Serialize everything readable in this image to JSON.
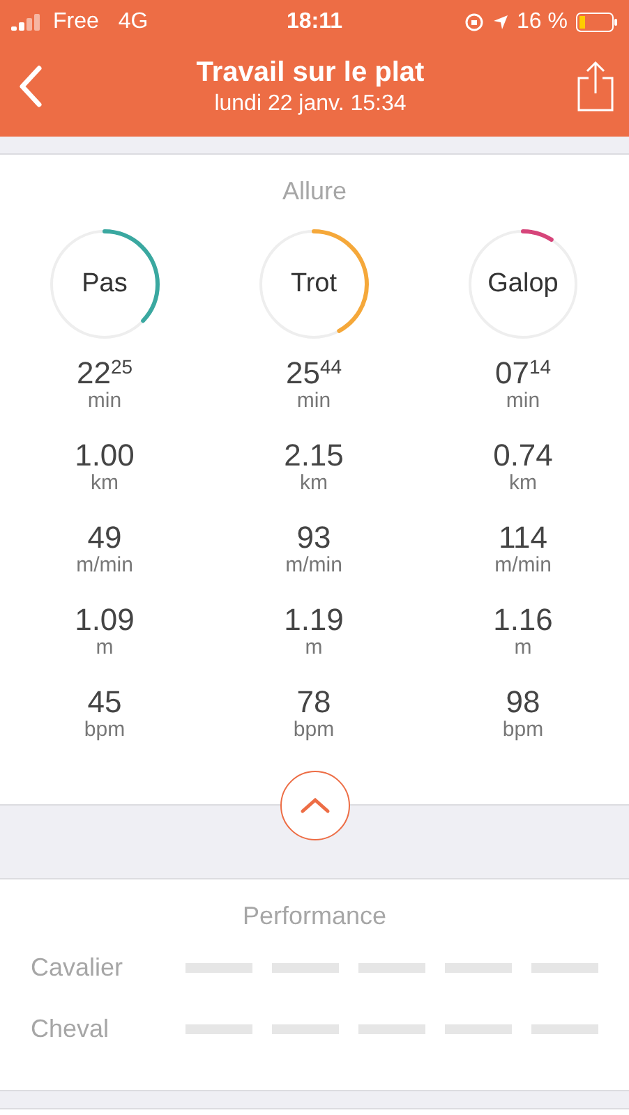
{
  "status_bar": {
    "carrier": "Free",
    "network": "4G",
    "time": "18:11",
    "battery": "16 %"
  },
  "header": {
    "title": "Travail sur le plat",
    "subtitle": "lundi 22 janv. 15:34"
  },
  "allure": {
    "title": "Allure",
    "gaits": [
      {
        "name": "Pas",
        "level": 0.37,
        "color": "#3aa8a0",
        "stats": [
          {
            "value": "22$^{25}$",
            "unit": "min"
          },
          {
            "value": "1.00",
            "unit": "km"
          },
          {
            "value": "49",
            "unit": "m/min"
          },
          {
            "value": "1.09",
            "unit": "m"
          },
          {
            "value": "45",
            "unit": "bpm"
          }
        ]
      },
      {
        "name": "Trot",
        "level": 0.42,
        "color": "#f5a83a",
        "stats": [
          {
            "value": "25$^{44}$",
            "unit": "min"
          },
          {
            "value": "2.15",
            "unit": "km"
          },
          {
            "value": "93",
            "unit": "m/min"
          },
          {
            "value": "1.19",
            "unit": "m"
          },
          {
            "value": "78",
            "unit": "bpm"
          }
        ]
      },
      {
        "name": "Galop",
        "level": 0.09,
        "color": "#d6457a",
        "stats": [
          {
            "value": "07$^{14}$",
            "unit": "min"
          },
          {
            "value": "0.74",
            "unit": "km"
          },
          {
            "value": "114",
            "unit": "m/min"
          },
          {
            "value": "1.16",
            "unit": "m"
          },
          {
            "value": "98",
            "unit": "bpm"
          }
        ]
      }
    ],
    "expanded": true
  },
  "performance": {
    "title": "Performance",
    "rows": [
      {
        "label": "Cavalier"
      },
      {
        "label": "Cheval"
      }
    ]
  }
}
